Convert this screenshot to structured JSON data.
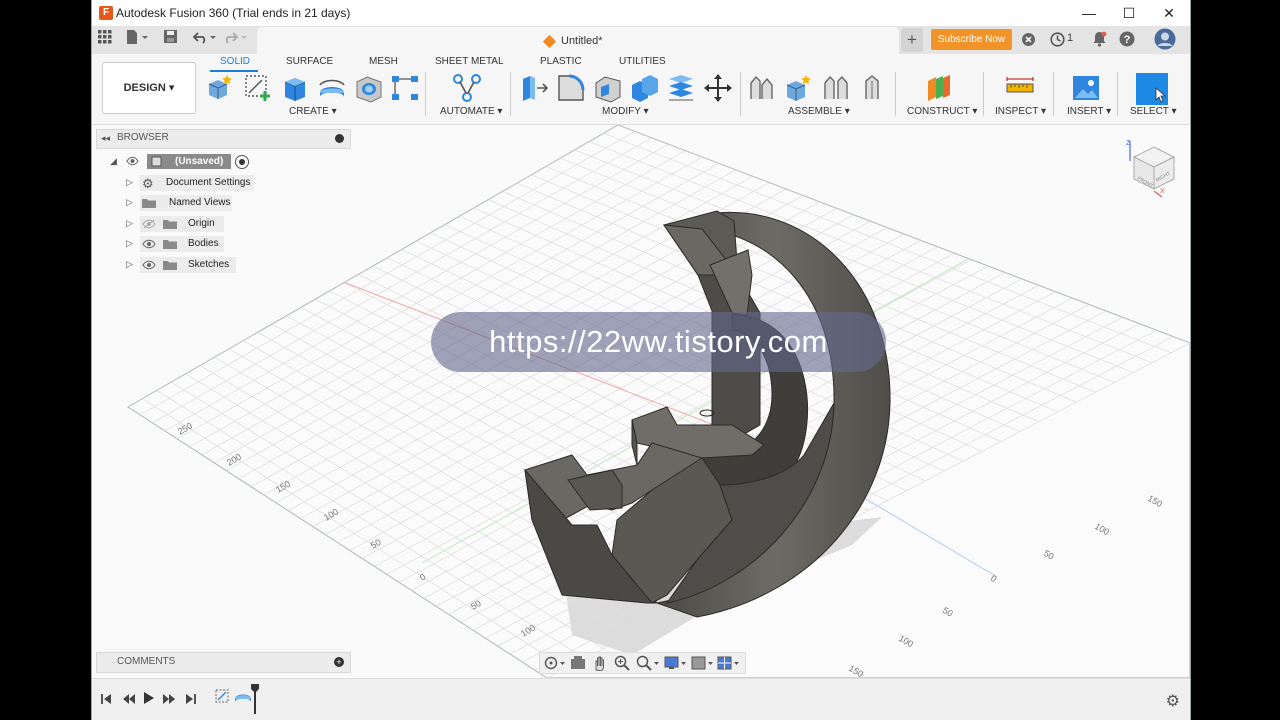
{
  "window": {
    "title": "Autodesk Fusion 360 (Trial ends in 21 days)",
    "app_icon_letter": "F",
    "minimize": "—",
    "maximize": "☐",
    "close": "✕"
  },
  "tabbar": {
    "doc_title": "Untitled*",
    "close_tab": "×",
    "add_tab": "+",
    "subscribe_label": "Subscribe Now",
    "jobs_count": "1"
  },
  "ribbon": {
    "workspace": "DESIGN ▾",
    "tabs": [
      "SOLID",
      "SURFACE",
      "MESH",
      "SHEET METAL",
      "PLASTIC",
      "UTILITIES"
    ],
    "groups": {
      "create": "CREATE ▾",
      "automate": "AUTOMATE ▾",
      "modify": "MODIFY ▾",
      "assemble": "ASSEMBLE ▾",
      "construct": "CONSTRUCT ▾",
      "inspect": "INSPECT ▾",
      "insert": "INSERT ▾",
      "select": "SELECT ▾"
    }
  },
  "browser": {
    "header": "BROWSER",
    "root": "(Unsaved)",
    "items": [
      "Document Settings",
      "Named Views",
      "Origin",
      "Bodies",
      "Sketches"
    ]
  },
  "comments": {
    "label": "COMMENTS"
  },
  "viewcube": {
    "faces": [
      "FRONT",
      "RIGHT"
    ],
    "axes": [
      "Z",
      "X"
    ]
  },
  "grid_labels": {
    "left_axis": [
      "250",
      "200",
      "150",
      "100",
      "50",
      "0",
      "50",
      "100"
    ],
    "right_axis": [
      "150",
      "100",
      "50",
      "0",
      "50",
      "100",
      "150"
    ]
  },
  "watermark": "https://22ww.tistory.com",
  "colors": {
    "accent": "#1a7fd4",
    "subscribe": "#f2932a",
    "app_brand": "#e8581c",
    "model_body": "#5f5d58"
  }
}
